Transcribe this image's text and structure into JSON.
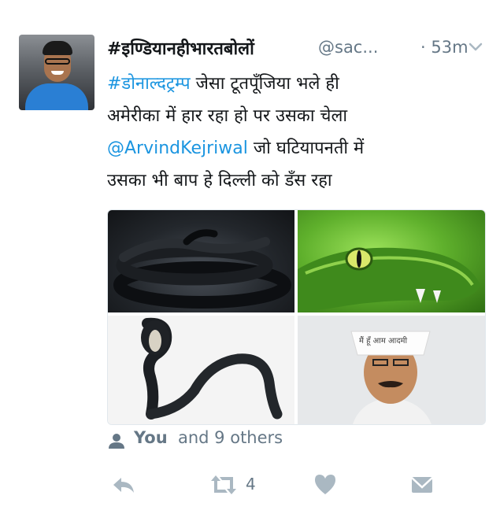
{
  "tweet": {
    "author": {
      "name": "#इण्डियानहीभारतबोलों",
      "handle": "@sac...",
      "time": "· 53m"
    },
    "text": {
      "line1_hashtag": "#डोनाल्दट्रम्प",
      "line1_rest": " जेसा टूतपूँजिया भले ही",
      "line2": "अमेरीका में हार रहा हो पर उसका चेला",
      "line3_mention": "@ArvindKejriwal",
      "line3_rest": " जो घटियापनती में",
      "line4": "उसका भी बाप हे दिल्ली को डँस रहा"
    },
    "media": {
      "cap_text": "मैं हूँ आम आदमी"
    },
    "social_context": {
      "you": "You",
      "others": " and 9 others"
    },
    "actions": {
      "retweet_count": "4"
    },
    "colors": {
      "link": "#1b95e0",
      "muted": "#657786",
      "icon": "#aab8c2"
    },
    "icons": [
      "caret-down-icon",
      "person-icon",
      "reply-icon",
      "retweet-icon",
      "heart-icon",
      "direct-message-icon"
    ]
  }
}
